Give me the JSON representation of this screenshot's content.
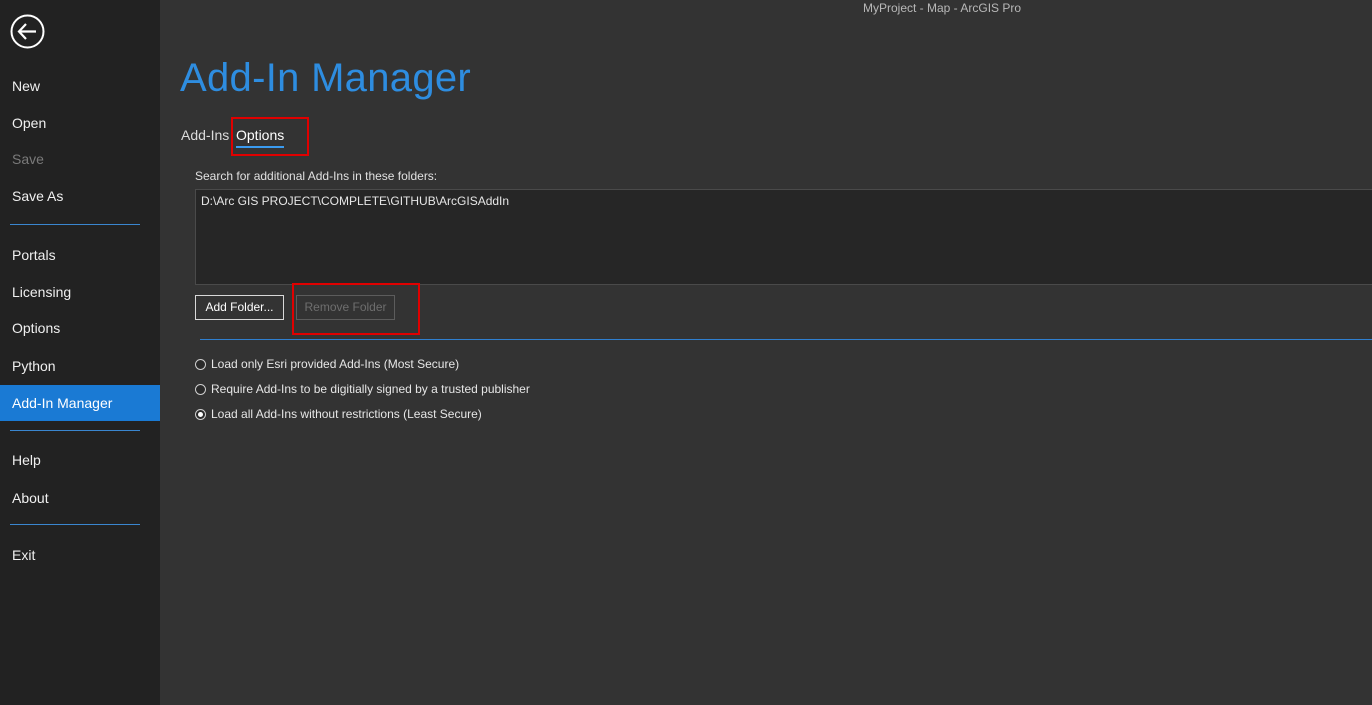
{
  "window": {
    "title": "MyProject - Map - ArcGIS Pro"
  },
  "sidebar": {
    "items": [
      {
        "label": "New"
      },
      {
        "label": "Open"
      },
      {
        "label": "Save"
      },
      {
        "label": "Save As"
      },
      {
        "label": "Portals"
      },
      {
        "label": "Licensing"
      },
      {
        "label": "Options"
      },
      {
        "label": "Python"
      },
      {
        "label": "Add-In Manager"
      },
      {
        "label": "Help"
      },
      {
        "label": "About"
      },
      {
        "label": "Exit"
      }
    ],
    "active_item": "Add-In Manager",
    "disabled_item": "Save"
  },
  "page": {
    "title": "Add-In Manager",
    "tabs": [
      {
        "label": "Add-Ins"
      },
      {
        "label": "Options"
      }
    ],
    "active_tab": "Options"
  },
  "options": {
    "search_label": "Search for additional Add-Ins in these folders:",
    "folders": [
      "D:\\Arc GIS PROJECT\\COMPLETE\\GITHUB\\ArcGISAddIn"
    ],
    "add_folder_label": "Add Folder...",
    "remove_folder_label": "Remove Folder",
    "security_options": [
      {
        "label": "Load only Esri provided Add-Ins (Most Secure)",
        "checked": false
      },
      {
        "label": "Require Add-Ins to be digitially signed by a trusted publisher",
        "checked": false
      },
      {
        "label": "Load all Add-Ins without restrictions (Least Secure)",
        "checked": true
      }
    ]
  },
  "colors": {
    "accent": "#2e8de0",
    "active_nav": "#1a7ad4",
    "highlight_box": "#e00000",
    "background": "#333333",
    "sidebar": "#222222"
  }
}
